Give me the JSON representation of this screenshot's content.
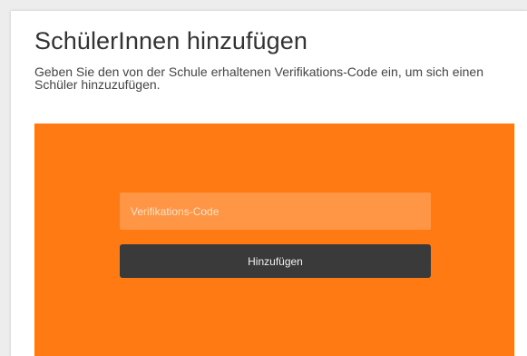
{
  "page": {
    "title": "SchülerInnen hinzufügen",
    "description": "Geben Sie den von der Schule erhaltenen Verifikations-Code ein, um sich einen Schüler hinzuzufügen."
  },
  "form": {
    "code_placeholder": "Verifikations-Code",
    "code_value": "",
    "submit_label": "Hinzufügen"
  },
  "colors": {
    "panel": "#ff7a12",
    "input": "#ff9646",
    "button": "#3a3a3a"
  }
}
